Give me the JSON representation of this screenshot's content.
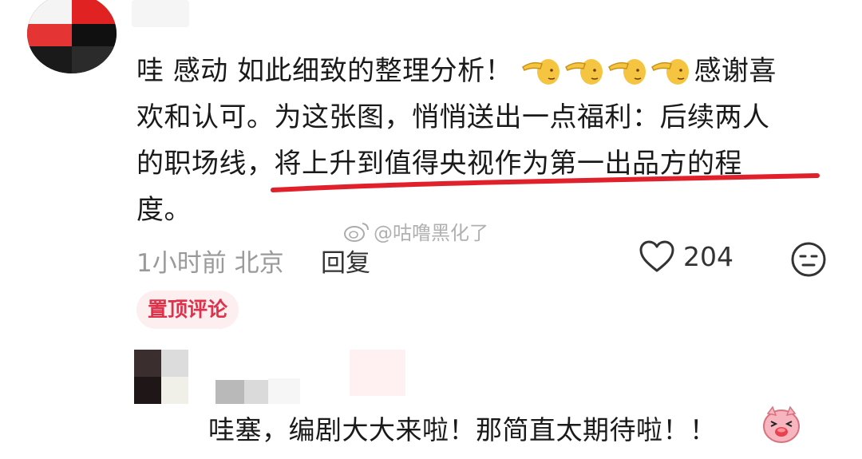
{
  "comment": {
    "text_line_1_a": "哇 感动 如此细致的整理分析！",
    "text_line_1_b": "感谢喜",
    "text_line_2": "欢和认可。为这张图，悄悄送出一点福利：后续两人",
    "text_line_3_a": "的职场线，",
    "text_line_3_b": "将上升到值得央视作为第一出品方的程",
    "text_line_4": "度。",
    "emoji_icons": [
      "hand-pointing-left-emoji",
      "hand-pointing-left-emoji",
      "hand-pointing-left-emoji",
      "hand-pointing-left-emoji"
    ],
    "underline_color": "#e0202b"
  },
  "watermark": {
    "text": "@咕噜黑化了",
    "icon": "weibo-logo-icon"
  },
  "meta": {
    "time_location": "1小时前 北京",
    "reply_label": "回复",
    "like_count": "204",
    "like_icon": "heart-outline-icon",
    "emoji_react_icon": "neutral-face-icon"
  },
  "pinned": {
    "label": "置顶评论",
    "color": "#e0314b",
    "background": "#fdeef0"
  },
  "reply": {
    "text": "哇塞，编剧大大来啦！那简直太期待啦！！",
    "emoji_icon": "excited-pig-emoji"
  }
}
